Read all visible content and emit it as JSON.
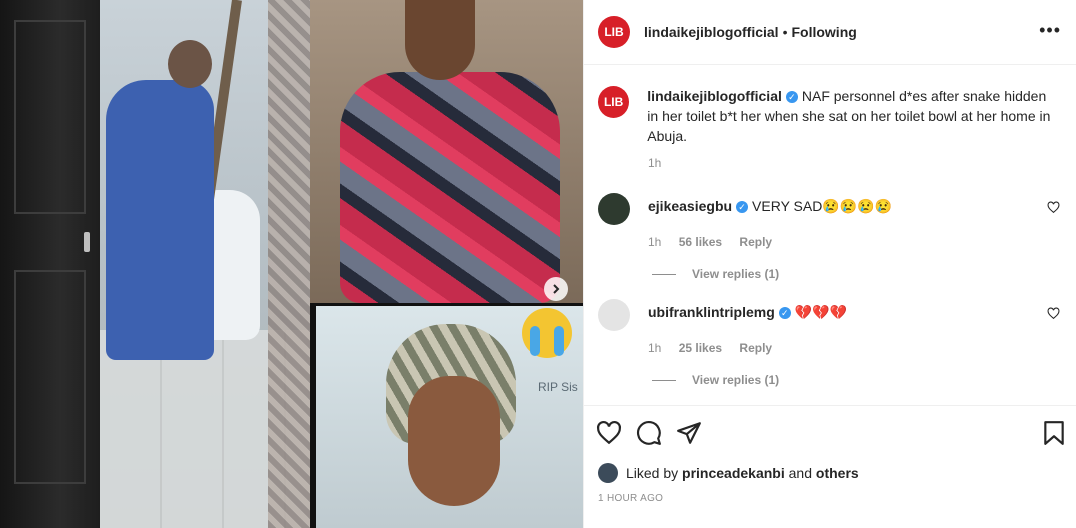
{
  "post": {
    "username": "lindaikejiblogofficial",
    "follow_status": "Following",
    "avatar_text": "LIB",
    "caption": "NAF personnel d*es after snake hidden in her toilet b*t her when she sat on her toilet bowl at her home in Abuja.",
    "caption_time": "1h",
    "overlay_text": "RIP Sis"
  },
  "comments": [
    {
      "username": "ejikeasiegbu",
      "text": "VERY SAD😢😢😢😢",
      "time": "1h",
      "likes": "56 likes",
      "reply": "Reply",
      "view_replies": "View replies (1)"
    },
    {
      "username": "ubifranklintriplemg",
      "text": "💔💔💔",
      "time": "1h",
      "likes": "25 likes",
      "reply": "Reply",
      "view_replies": "View replies (1)"
    }
  ],
  "liked_by": {
    "prefix": "Liked by",
    "user": "princeadekanbi",
    "and": "and",
    "others": "others"
  },
  "timestamp": "1 HOUR AGO",
  "colors": {
    "verified": "#3897f0",
    "brand": "#d71f28",
    "muted": "#8e8e8e"
  },
  "icons": [
    "more-icon",
    "heart-icon",
    "comment-icon",
    "share-icon",
    "bookmark-icon",
    "next-arrow-icon",
    "verified-icon"
  ]
}
